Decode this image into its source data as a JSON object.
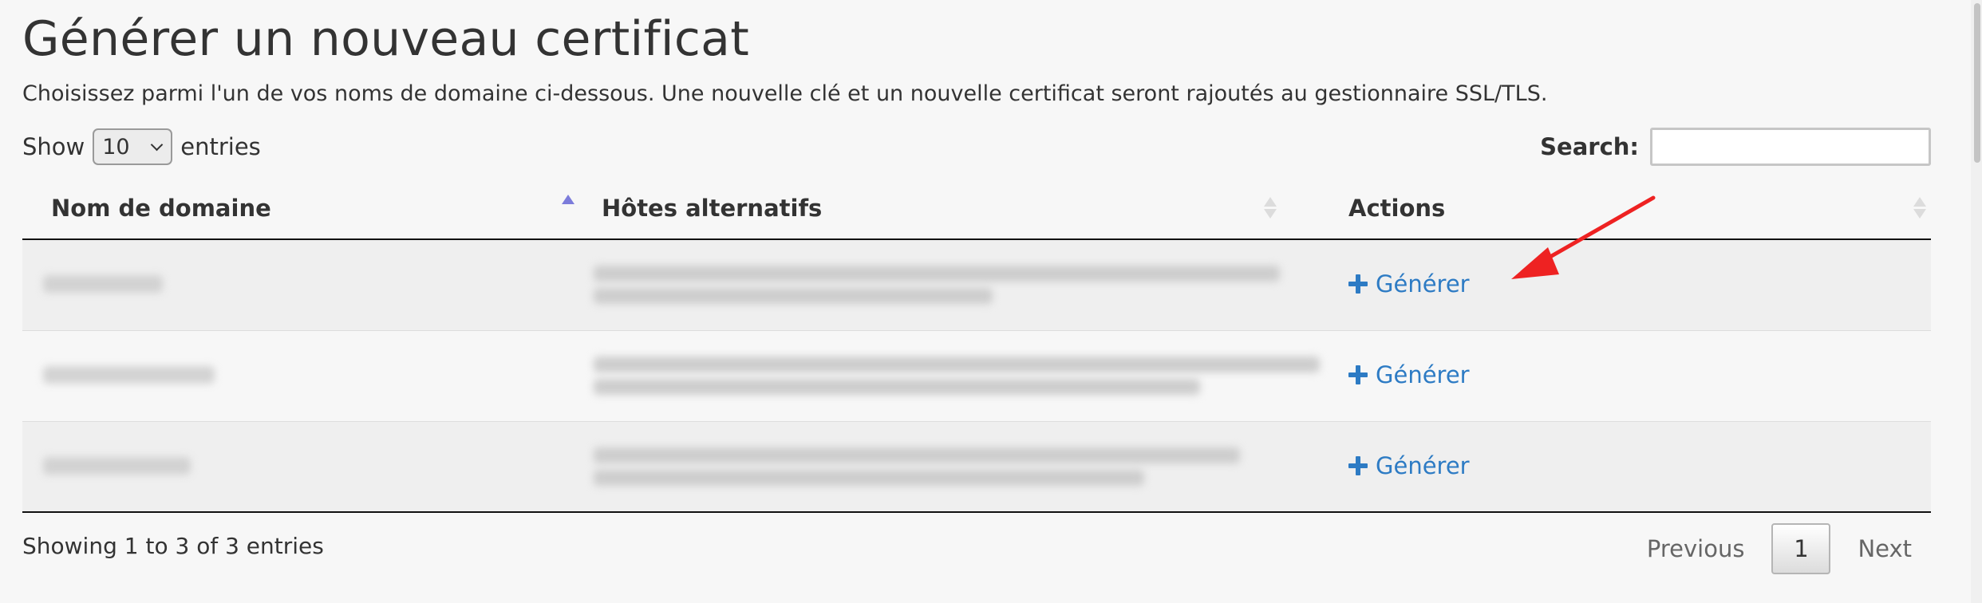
{
  "page": {
    "title": "Générer un nouveau certificat",
    "subtitle": "Choisissez parmi l'un de vos noms de domaine ci-dessous. Une nouvelle clé et un nouvelle certificat seront rajoutés au gestionnaire SSL/TLS."
  },
  "controls": {
    "show_label": "Show",
    "entries_value": "10",
    "entries_label": "entries",
    "search_label": "Search:",
    "search_value": ""
  },
  "table": {
    "columns": [
      "Nom de domaine",
      "Hôtes alternatifs",
      "Actions"
    ],
    "sort": {
      "column": "Nom de domaine",
      "direction": "ascending"
    },
    "rows": [
      {
        "domain": "[blurred]",
        "alt_hosts": "[blurred]",
        "action": "Générer"
      },
      {
        "domain": "[blurred]",
        "alt_hosts": "[blurred]",
        "action": "Générer"
      },
      {
        "domain": "[blurred]",
        "alt_hosts": "[blurred]",
        "action": "Générer"
      }
    ]
  },
  "footer": {
    "info": "Showing 1 to 3 of 3 entries",
    "previous": "Previous",
    "current_page": "1",
    "next": "Next"
  },
  "colors": {
    "link": "#2d7bc4",
    "annotation_arrow": "#ee2222",
    "sort_active": "#7c7cdb"
  },
  "icons": {
    "action_icon": "plus-icon",
    "annotation": "red-arrow-icon"
  }
}
